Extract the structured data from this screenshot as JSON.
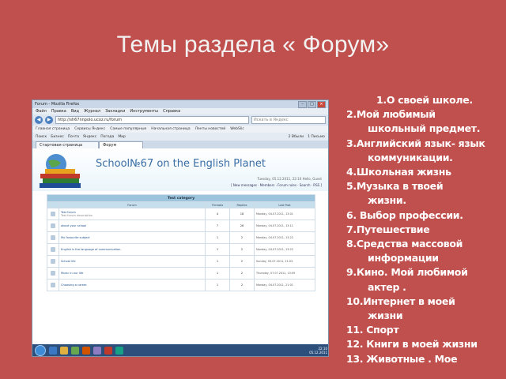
{
  "slide": {
    "title": "Темы раздела « Форум»"
  },
  "browser": {
    "window_title": "Forum - Mozilla Firefox",
    "menu": [
      "Файл",
      "Правка",
      "Вид",
      "Журнал",
      "Закладки",
      "Инструменты",
      "Справка"
    ],
    "url": "http://sh67nnpolo.ucoz.ru/forum",
    "search_placeholder": "Искать в Яндекс",
    "bookmarks": [
      "Главная страница",
      "Сервисы Яндекс",
      "Самые популярные",
      "Начальная страница",
      "Ленты новостей",
      "WebSlic"
    ],
    "toolbar2": [
      "Поиск",
      "Бизнес",
      "Почта",
      "Яндекс",
      "Погода",
      "Мир"
    ],
    "toolbar2_right": [
      "2 Вбыли",
      "1 Письмо"
    ],
    "tab_label": "Стартовая страница Firefox",
    "tab2_label": "Форум"
  },
  "site": {
    "title": "School№67 on the English Planet",
    "date": "Tuesday, 05.12.2011, 22:10",
    "greeting": "Hello, Guest",
    "subnav": "[ New messages · Members · Forum rules · Search · RSS ]"
  },
  "forum": {
    "category": "Test category",
    "headers": [
      "Forum",
      "Threads",
      "Replies",
      "Last Post"
    ],
    "rows": [
      {
        "name": "Test forum",
        "desc": "Test forum description",
        "threads": "4",
        "replies": "18",
        "last": "Monday, 04.07.2011, 13:01"
      },
      {
        "name": "about your school",
        "desc": "",
        "threads": "7",
        "replies": "28",
        "last": "Monday, 04.07.2011, 13:11"
      },
      {
        "name": "My favourite subject",
        "desc": "",
        "threads": "1",
        "replies": "2",
        "last": "Monday, 04.07.2011, 13:22"
      },
      {
        "name": "English is the language of communication.",
        "desc": "",
        "threads": "1",
        "replies": "2",
        "last": "Monday, 04.07.2011, 13:22"
      },
      {
        "name": "School life",
        "desc": "",
        "threads": "1",
        "replies": "2",
        "last": "Sunday, 03.07.2011, 21:03"
      },
      {
        "name": "Music in our life",
        "desc": "",
        "threads": "1",
        "replies": "2",
        "last": "Thursday, 07.07.2011, 13:09"
      },
      {
        "name": "Choosing a career.",
        "desc": "",
        "threads": "1",
        "replies": "2",
        "last": "Monday, 04.07.2011, 21:01"
      }
    ]
  },
  "taskbar": {
    "time": "22:10",
    "date": "05.12.2011"
  },
  "topics": [
    "1.О своей школе.",
    "2.Мой любимый",
    "школьный предмет.",
    "3.Английский язык- язык",
    "коммуникации.",
    "4.Школьная жизнь",
    "5.Музыка в твоей",
    "жизни.",
    "6. Выбор профессии.",
    "7.Путешествие",
    "8.Средства массовой",
    "информации",
    "9.Кино. Мой любимой",
    "актер .",
    "10.Интернет в моей",
    "жизни",
    "11. Спорт",
    "12. Книги в моей жизни",
    "13. Животные . Мое"
  ],
  "colors": {
    "background": "#c0504d",
    "text": "#ffffff",
    "site_accent": "#3a6ea5"
  }
}
